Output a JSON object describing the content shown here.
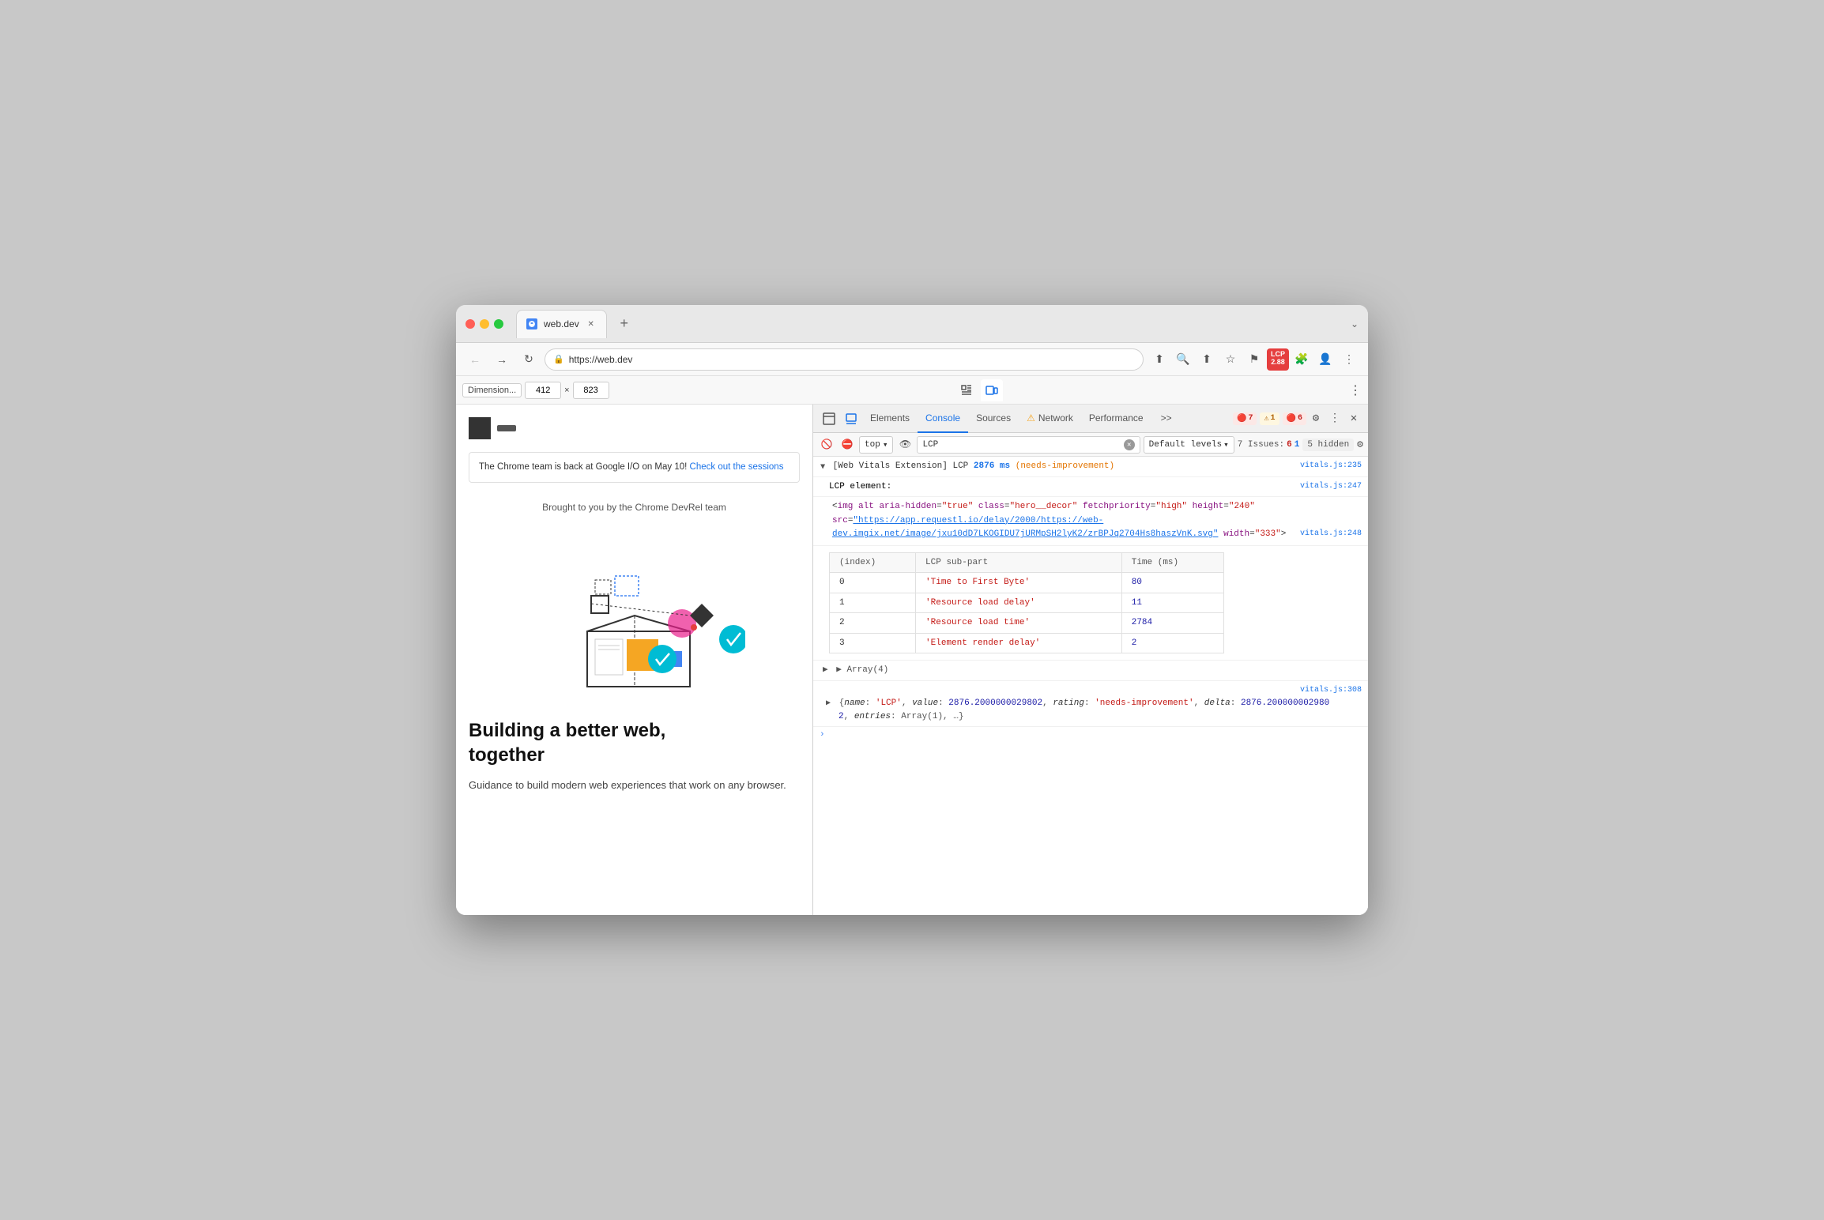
{
  "browser": {
    "tab_title": "web.dev",
    "tab_url": "https://web.dev",
    "new_tab_label": "+",
    "more_label": "⌄"
  },
  "nav": {
    "back": "←",
    "forward": "→",
    "refresh": "↻",
    "url": "https://web.dev",
    "lcp_badge": "LCP\n2.88"
  },
  "dim_bar": {
    "label": "Dimension...",
    "width": "412",
    "height": "823",
    "sep": "×",
    "more": "⋮"
  },
  "web_page": {
    "banner_text": "The Chrome team is back at Google I/O on May 10!",
    "banner_link": "Check out the sessions",
    "credit": "Brought to you by the Chrome DevRel team",
    "hero_title": "Building a better web,\ntogether",
    "hero_desc": "Guidance to build modern web experiences\nthat work on any browser."
  },
  "devtools": {
    "tabs": [
      "Elements",
      "Console",
      "Sources",
      "Network",
      "Performance"
    ],
    "active_tab": "Console",
    "network_warning": true,
    "more_tabs": ">>"
  },
  "devtools_badges": {
    "err1": "7",
    "err2": "1",
    "err3": "6",
    "settings": "⚙",
    "more": "⋮",
    "close": "✕"
  },
  "console_toolbar": {
    "top": "top",
    "search_val": "LCP",
    "levels": "Default levels",
    "issues_label": "7 Issues:",
    "issues_red": "6",
    "issues_blue": "1",
    "hidden": "5 hidden"
  },
  "console_entries": {
    "lcp_header": "[Web Vitals Extension] LCP",
    "lcp_ms": "2876 ms",
    "lcp_rating": "(needs-improvement)",
    "source1": "vitals.js:235",
    "lcp_element_label": "LCP element:",
    "source2": "vitals.js:247",
    "img_tag_open": "<img alt aria-hidden=\"true\" class=\"hero__decor\" fetchpriority=\"high\" height=\"240\" src=\"",
    "img_src_url": "https://app.requestl.io/delay/2000/https://web-dev.imgix.net/image/jxu10dD7LKOGIDU7jURMpSH2lyK2/zrBPJq2704Hs8haszVnK.svg",
    "img_tag_close": "\" width=\"333\">",
    "source3": "vitals.js:248",
    "table_cols": [
      "(index)",
      "LCP sub-part",
      "Time (ms)"
    ],
    "table_rows": [
      {
        "index": "0",
        "part": "'Time to First Byte'",
        "time": "80"
      },
      {
        "index": "1",
        "part": "'Resource load delay'",
        "time": "11"
      },
      {
        "index": "2",
        "part": "'Resource load time'",
        "time": "2784"
      },
      {
        "index": "3",
        "part": "'Element render delay'",
        "time": "2"
      }
    ],
    "array_summary": "▶ Array(4)",
    "source4": "vitals.js:308",
    "obj_inline": "{name: 'LCP', value: 2876.2000000029802, rating: 'needs-improvement', delta: 2876.200000029802, entries: Array(1), …}",
    "obj_name_key": "name",
    "obj_name_val": "'LCP'",
    "obj_value_key": "value",
    "obj_value_val": "2876.2000000029802",
    "obj_rating_key": "rating",
    "obj_rating_val": "'needs-improvement'",
    "obj_delta_key": "delta",
    "obj_delta_val": "2876.200000002980",
    "obj_entries_key": "entries",
    "obj_entries_val": "Array(1)"
  }
}
